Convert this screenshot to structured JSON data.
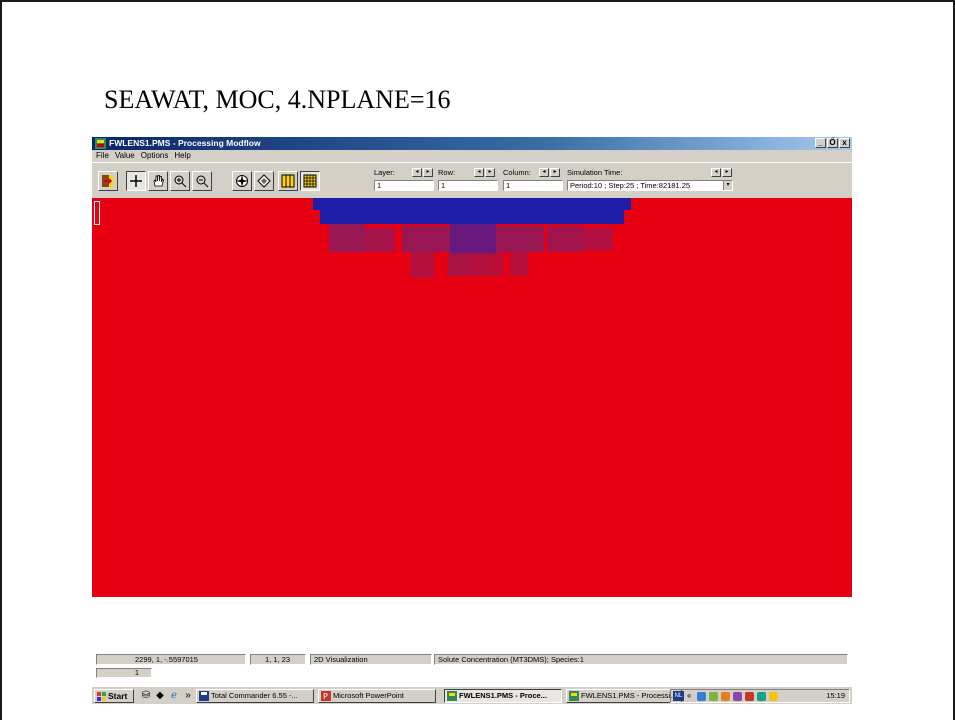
{
  "slide": {
    "title": "SEAWAT, MOC, 4.NPLANE=16"
  },
  "window": {
    "title": "FWLENS1.PMS - Processing Modflow",
    "controls": {
      "minimize": "_",
      "restore": "Ő",
      "close": "x"
    }
  },
  "menu": {
    "items": [
      "File",
      "Value",
      "Options",
      "Help"
    ]
  },
  "toolbar": {
    "layer_label": "Layer:",
    "layer_value": "1",
    "row_label": "Row:",
    "row_value": "1",
    "column_label": "Column:",
    "column_value": "1",
    "sim_time_label": "Simulation Time:",
    "sim_time_value": "Period:10 ; Step:25 ; Time:82181.25",
    "spin_left": "◂",
    "spin_right": "▸",
    "dropdown_arrow": "▾"
  },
  "visualization": {
    "background_color": "#e60012",
    "high_color": "#1e1ea8",
    "mixed_color": "#8a1a5e"
  },
  "statusbar": {
    "coords": "2299,    1, -.5597015",
    "cell": "1, 1, 23",
    "mode": "2D Visualization",
    "quantity": "Solute Concentration (MT3DMS); Species:1",
    "secondary": "1"
  },
  "taskbar": {
    "start_label": "Start",
    "chevron": "»",
    "tasks": [
      "Total Commander 6.55 -...",
      "Microsoft PowerPoint",
      "FWLENS1.PMS - Proce...",
      "FWLENS1.PMS - Processi..."
    ],
    "tray_lang": "NL",
    "tray_chevron": "«",
    "clock": "15:19"
  }
}
